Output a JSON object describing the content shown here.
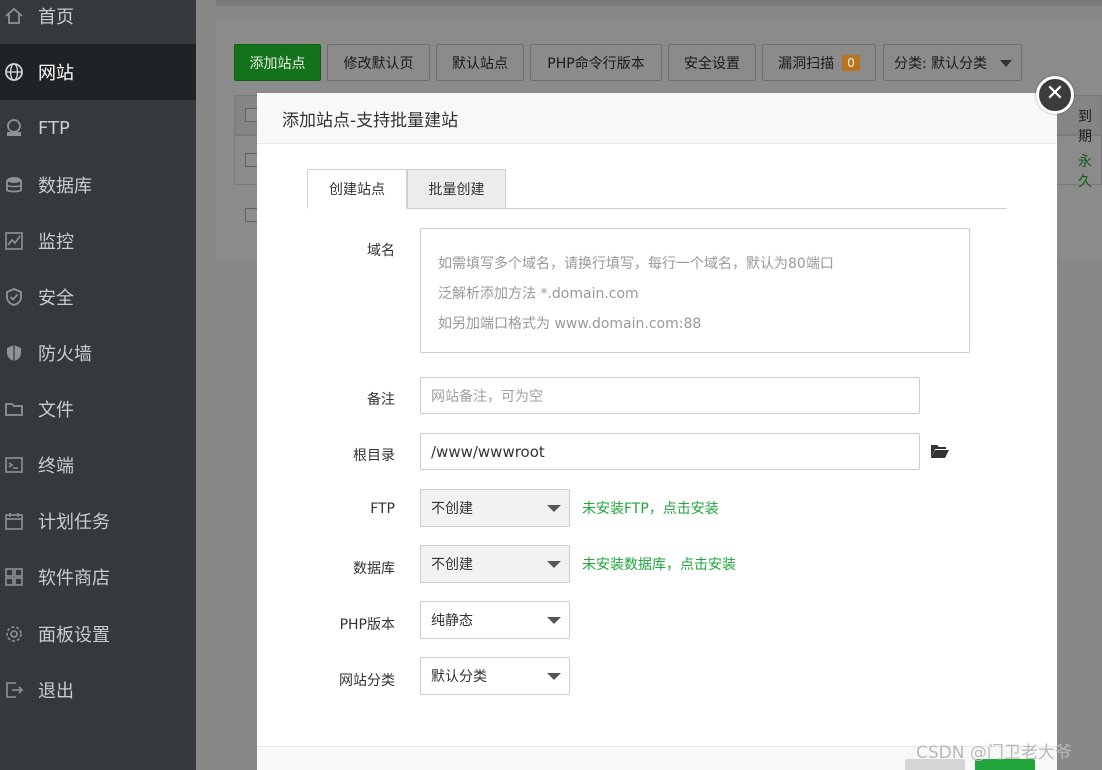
{
  "sidebar": {
    "items": [
      {
        "label": "首页",
        "icon": "home-icon"
      },
      {
        "label": "网站",
        "icon": "globe-icon",
        "active": true
      },
      {
        "label": "FTP",
        "icon": "ftp-icon"
      },
      {
        "label": "数据库",
        "icon": "database-icon"
      },
      {
        "label": "监控",
        "icon": "monitor-icon"
      },
      {
        "label": "安全",
        "icon": "shield-check-icon"
      },
      {
        "label": "防火墙",
        "icon": "firewall-icon"
      },
      {
        "label": "文件",
        "icon": "folder-icon"
      },
      {
        "label": "终端",
        "icon": "terminal-icon"
      },
      {
        "label": "计划任务",
        "icon": "calendar-icon"
      },
      {
        "label": "软件商店",
        "icon": "apps-icon"
      },
      {
        "label": "面板设置",
        "icon": "gear-icon"
      },
      {
        "label": "退出",
        "icon": "logout-icon"
      }
    ]
  },
  "toolbar": {
    "add_site": "添加站点",
    "edit_default_page": "修改默认页",
    "default_site": "默认站点",
    "php_cli_version": "PHP命令行版本",
    "security_settings": "安全设置",
    "vuln_scan": "漏洞扫描",
    "vuln_count": "0",
    "category": "分类: 默认分类"
  },
  "table": {
    "expire_header": "到期",
    "expire_value": "永久"
  },
  "modal": {
    "title": "添加站点-支持批量建站",
    "tabs": [
      "创建站点",
      "批量创建"
    ],
    "form": {
      "domain_label": "域名",
      "domain_placeholder_lines": [
        "如需填写多个域名，请换行填写，每行一个域名，默认为80端口",
        "泛解析添加方法 *.domain.com",
        "如另加端口格式为 www.domain.com:88"
      ],
      "remark_label": "备注",
      "remark_placeholder": "网站备注，可为空",
      "root_label": "根目录",
      "root_value": "/www/wwwroot",
      "ftp_label": "FTP",
      "ftp_value": "不创建",
      "ftp_hint": "未安装FTP，点击安装",
      "db_label": "数据库",
      "db_value": "不创建",
      "db_hint": "未安装数据库，点击安装",
      "php_label": "PHP版本",
      "php_value": "纯静态",
      "category_label": "网站分类",
      "category_value": "默认分类"
    }
  },
  "watermark": "CSDN @门卫老大爷",
  "colors": {
    "primary_green": "#20a53a",
    "sidebar_bg": "#34393e",
    "sidebar_active": "#1f2326"
  }
}
